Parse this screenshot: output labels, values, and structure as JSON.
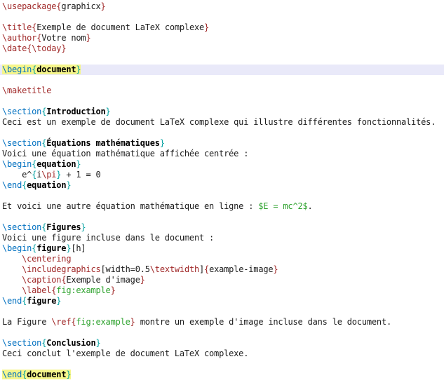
{
  "app": {
    "kind": "latex-source-editor",
    "language": "LaTeX"
  },
  "palette": {
    "background": "#ffffff",
    "text_default": "#1b1b1b",
    "command_red": "#a02828",
    "keyword_blue": "#0070c0",
    "brace_teal": "#00a0a0",
    "math_green": "#2fa32f",
    "env_name_bold": "#000000",
    "mark_yellow": "#f5f58b",
    "current_line_lavender": "#e9e9f9"
  },
  "editor": {
    "lines": [
      {
        "tokens": [
          {
            "c": "red",
            "t": "\\usepackage"
          },
          {
            "c": "red",
            "t": "{"
          },
          {
            "c": "black",
            "t": "graphicx"
          },
          {
            "c": "red",
            "t": "}"
          }
        ]
      },
      {
        "tokens": []
      },
      {
        "tokens": [
          {
            "c": "red",
            "t": "\\title"
          },
          {
            "c": "red",
            "t": "{"
          },
          {
            "c": "black",
            "t": "Exemple de document LaTeX complexe"
          },
          {
            "c": "red",
            "t": "}"
          }
        ]
      },
      {
        "tokens": [
          {
            "c": "red",
            "t": "\\author"
          },
          {
            "c": "red",
            "t": "{"
          },
          {
            "c": "black",
            "t": "Votre nom"
          },
          {
            "c": "red",
            "t": "}"
          }
        ]
      },
      {
        "tokens": [
          {
            "c": "red",
            "t": "\\date"
          },
          {
            "c": "red",
            "t": "{"
          },
          {
            "c": "red",
            "t": "\\today"
          },
          {
            "c": "red",
            "t": "}"
          }
        ]
      },
      {
        "tokens": []
      },
      {
        "cursor_line": true,
        "marked": true,
        "tokens": [
          {
            "c": "blue",
            "t": "\\begin"
          },
          {
            "c": "teal",
            "t": "{"
          },
          {
            "c": "bold",
            "t": "document"
          },
          {
            "c": "teal",
            "t": "}"
          }
        ]
      },
      {
        "tokens": []
      },
      {
        "tokens": [
          {
            "c": "red",
            "t": "\\maketitle"
          }
        ]
      },
      {
        "tokens": []
      },
      {
        "tokens": [
          {
            "c": "blue",
            "t": "\\section"
          },
          {
            "c": "teal",
            "t": "{"
          },
          {
            "c": "bold",
            "t": "Introduction"
          },
          {
            "c": "teal",
            "t": "}"
          }
        ]
      },
      {
        "tokens": [
          {
            "c": "black",
            "t": "Ceci est un exemple de document LaTeX complexe qui illustre différentes fonctionnalités."
          }
        ]
      },
      {
        "tokens": []
      },
      {
        "tokens": [
          {
            "c": "blue",
            "t": "\\section"
          },
          {
            "c": "teal",
            "t": "{"
          },
          {
            "c": "bold",
            "t": "Équations mathématiques"
          },
          {
            "c": "teal",
            "t": "}"
          }
        ]
      },
      {
        "tokens": [
          {
            "c": "black",
            "t": "Voici une équation mathématique affichée centrée :"
          }
        ]
      },
      {
        "tokens": [
          {
            "c": "blue",
            "t": "\\begin"
          },
          {
            "c": "teal",
            "t": "{"
          },
          {
            "c": "bold",
            "t": "equation"
          },
          {
            "c": "teal",
            "t": "}"
          }
        ]
      },
      {
        "tokens": [
          {
            "c": "black",
            "t": "    e^"
          },
          {
            "c": "teal",
            "t": "{"
          },
          {
            "c": "black",
            "t": "i"
          },
          {
            "c": "red",
            "t": "\\pi"
          },
          {
            "c": "teal",
            "t": "}"
          },
          {
            "c": "black",
            "t": " + 1 = 0"
          }
        ]
      },
      {
        "tokens": [
          {
            "c": "blue",
            "t": "\\end"
          },
          {
            "c": "teal",
            "t": "{"
          },
          {
            "c": "bold",
            "t": "equation"
          },
          {
            "c": "teal",
            "t": "}"
          }
        ]
      },
      {
        "tokens": []
      },
      {
        "tokens": [
          {
            "c": "black",
            "t": "Et voici une autre équation mathématique en ligne : "
          },
          {
            "c": "green",
            "t": "$E = mc^2$"
          },
          {
            "c": "black",
            "t": "."
          }
        ]
      },
      {
        "tokens": []
      },
      {
        "tokens": [
          {
            "c": "blue",
            "t": "\\section"
          },
          {
            "c": "teal",
            "t": "{"
          },
          {
            "c": "bold",
            "t": "Figures"
          },
          {
            "c": "teal",
            "t": "}"
          }
        ]
      },
      {
        "tokens": [
          {
            "c": "black",
            "t": "Voici une figure incluse dans le document :"
          }
        ]
      },
      {
        "tokens": [
          {
            "c": "blue",
            "t": "\\begin"
          },
          {
            "c": "teal",
            "t": "{"
          },
          {
            "c": "bold",
            "t": "figure"
          },
          {
            "c": "teal",
            "t": "}"
          },
          {
            "c": "black",
            "t": "[h]"
          }
        ]
      },
      {
        "tokens": [
          {
            "c": "black",
            "t": "    "
          },
          {
            "c": "red",
            "t": "\\centering"
          }
        ]
      },
      {
        "tokens": [
          {
            "c": "black",
            "t": "    "
          },
          {
            "c": "red",
            "t": "\\includegraphics"
          },
          {
            "c": "black",
            "t": "[width=0.5"
          },
          {
            "c": "red",
            "t": "\\textwidth"
          },
          {
            "c": "black",
            "t": "]"
          },
          {
            "c": "red",
            "t": "{"
          },
          {
            "c": "black",
            "t": "example-image"
          },
          {
            "c": "red",
            "t": "}"
          }
        ]
      },
      {
        "tokens": [
          {
            "c": "black",
            "t": "    "
          },
          {
            "c": "red",
            "t": "\\caption"
          },
          {
            "c": "red",
            "t": "{"
          },
          {
            "c": "black",
            "t": "Exemple d'image"
          },
          {
            "c": "red",
            "t": "}"
          }
        ]
      },
      {
        "tokens": [
          {
            "c": "black",
            "t": "    "
          },
          {
            "c": "red",
            "t": "\\label"
          },
          {
            "c": "red",
            "t": "{"
          },
          {
            "c": "green",
            "t": "fig:example"
          },
          {
            "c": "red",
            "t": "}"
          }
        ]
      },
      {
        "tokens": [
          {
            "c": "blue",
            "t": "\\end"
          },
          {
            "c": "teal",
            "t": "{"
          },
          {
            "c": "bold",
            "t": "figure"
          },
          {
            "c": "teal",
            "t": "}"
          }
        ]
      },
      {
        "tokens": []
      },
      {
        "tokens": [
          {
            "c": "black",
            "t": "La Figure "
          },
          {
            "c": "red",
            "t": "\\ref"
          },
          {
            "c": "red",
            "t": "{"
          },
          {
            "c": "green",
            "t": "fig:example"
          },
          {
            "c": "red",
            "t": "}"
          },
          {
            "c": "black",
            "t": " montre un exemple d'image incluse dans le document."
          }
        ]
      },
      {
        "tokens": []
      },
      {
        "tokens": [
          {
            "c": "blue",
            "t": "\\section"
          },
          {
            "c": "teal",
            "t": "{"
          },
          {
            "c": "bold",
            "t": "Conclusion"
          },
          {
            "c": "teal",
            "t": "}"
          }
        ]
      },
      {
        "tokens": [
          {
            "c": "black",
            "t": "Ceci conclut l'exemple de document LaTeX complexe."
          }
        ]
      },
      {
        "tokens": []
      },
      {
        "marked": true,
        "tokens": [
          {
            "c": "blue",
            "t": "\\end"
          },
          {
            "c": "teal",
            "t": "{"
          },
          {
            "c": "bold",
            "t": "document"
          },
          {
            "c": "teal",
            "t": "}"
          }
        ]
      }
    ]
  }
}
